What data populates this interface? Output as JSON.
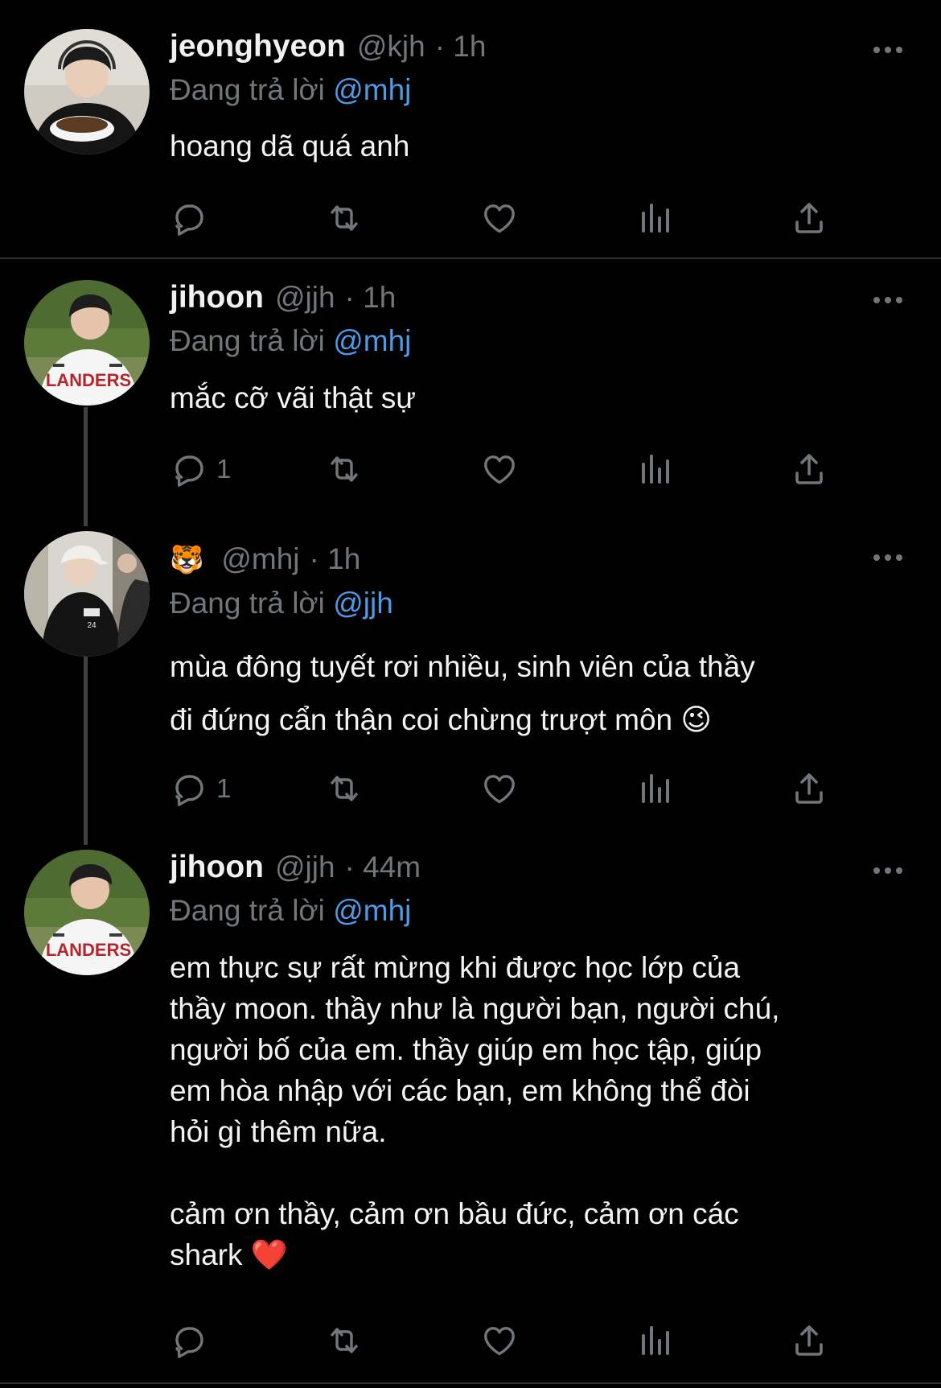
{
  "tweets": [
    {
      "display_name": "jeonghyeon",
      "handle": "@kjh",
      "time": "· 1h",
      "replying_prefix": "Đang trả lời",
      "replying_to": "@mhj",
      "text": "hoang dã quá anh",
      "reply_count": "",
      "avatar": "person-with-bowl"
    },
    {
      "display_name": "jihoon",
      "handle": "@jjh",
      "time": "· 1h",
      "replying_prefix": "Đang trả lời",
      "replying_to": "@mhj",
      "text": "mắc cỡ vãi thật sự",
      "reply_count": "1",
      "avatar": "baseball-jersey"
    },
    {
      "display_name": "🐯",
      "handle": "@mhj",
      "time": "· 1h",
      "replying_prefix": "Đang trả lời",
      "replying_to": "@jjh",
      "text": "mùa đông tuyết rơi nhiều, sinh viên của thầy\nđi đứng cẩn thận coi chừng trượt môn 😉",
      "reply_count": "1",
      "avatar": "person-with-cap"
    },
    {
      "display_name": "jihoon",
      "handle": "@jjh",
      "time": "· 44m",
      "replying_prefix": "Đang trả lời",
      "replying_to": "@mhj",
      "text": "em thực sự rất mừng khi được học lớp của\nthầy moon. thầy như là người bạn, người chú,\nngười bố của em. thầy giúp em học tập, giúp\nem hòa nhập với các bạn, em không thể đòi\nhỏi gì thêm nữa.\n\ncảm ơn thầy, cảm ơn bầu đức, cảm ơn các\nshark ❤️",
      "reply_count": "",
      "avatar": "baseball-jersey"
    }
  ],
  "colors": {
    "background": "#000000",
    "text": "#e7e9ea",
    "muted": "#71767b",
    "mention": "#4d9ae8",
    "thread_line": "#3e4144",
    "separator": "#2f3336"
  },
  "icons": {
    "reply": "reply-icon",
    "retweet": "retweet-icon",
    "like": "heart-icon",
    "views": "views-icon",
    "share": "share-icon",
    "more": "more-options-icon"
  }
}
